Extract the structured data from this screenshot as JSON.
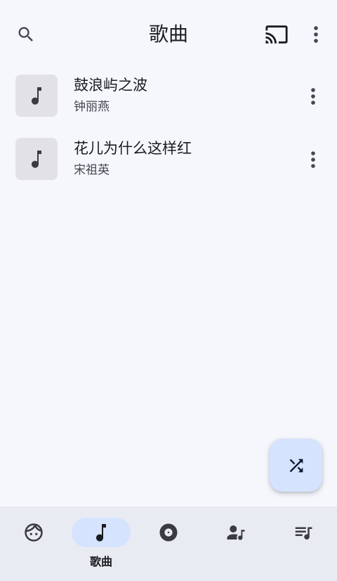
{
  "header": {
    "title": "歌曲",
    "search_icon": "search-icon",
    "cast_icon": "cast-icon",
    "more_icon": "more-vert-icon"
  },
  "songs": [
    {
      "title": "鼓浪屿之波",
      "artist": "钟丽燕",
      "icon": "music-note-icon"
    },
    {
      "title": "花儿为什么这样红",
      "artist": "宋祖英",
      "icon": "music-note-icon"
    }
  ],
  "fab": {
    "icon": "shuffle-icon"
  },
  "nav": {
    "items": [
      {
        "icon": "face-icon",
        "label": ""
      },
      {
        "icon": "music-note-icon",
        "label": "歌曲",
        "active": true
      },
      {
        "icon": "album-icon",
        "label": ""
      },
      {
        "icon": "artist-icon",
        "label": ""
      },
      {
        "icon": "playlist-icon",
        "label": ""
      }
    ]
  },
  "colors": {
    "background": "#f5f7fd",
    "nav_background": "#e9ebf3",
    "accent_container": "#d5e3ff",
    "thumb_background": "#e2e2e6",
    "icon": "#44474e"
  }
}
